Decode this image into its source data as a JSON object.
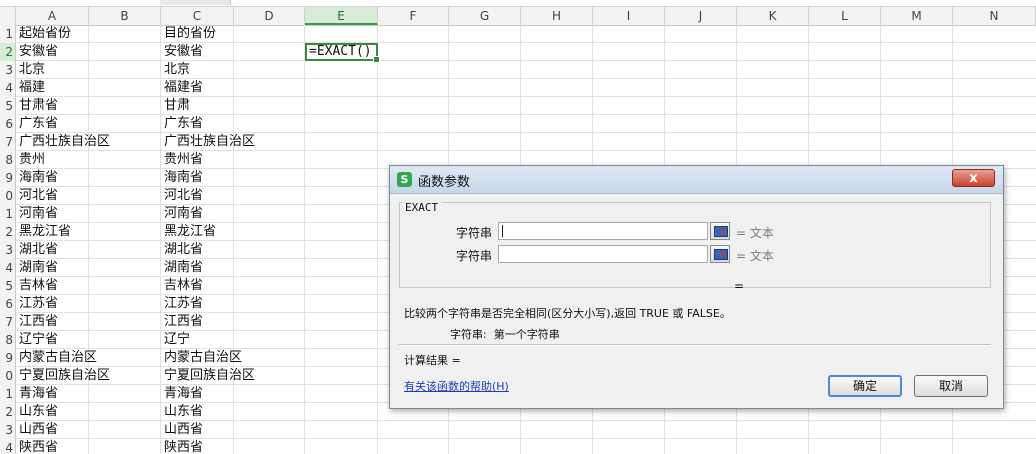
{
  "sheet": {
    "columns": [
      "A",
      "B",
      "C",
      "D",
      "E",
      "F",
      "G",
      "H",
      "I",
      "J",
      "K",
      "L",
      "M",
      "N"
    ],
    "active_column": "E",
    "row_labels": [
      "1",
      "2",
      "3",
      "4",
      "5",
      "6",
      "7",
      "8",
      "9",
      "0",
      "1",
      "2",
      "3",
      "4",
      "5",
      "6",
      "7",
      "8",
      "9",
      "0",
      "1",
      "2",
      "3",
      "4"
    ],
    "active_row_index": 1,
    "col_a": [
      "起始省份",
      "安徽省",
      "北京",
      "福建",
      "甘肃省",
      "广东省",
      "广西壮族自治区",
      "贵州",
      "海南省",
      "河北省",
      "河南省",
      "黑龙江省",
      "湖北省",
      "湖南省",
      "吉林省",
      "江苏省",
      "江西省",
      "辽宁省",
      "内蒙古自治区",
      "宁夏回族自治区",
      "青海省",
      "山东省",
      "山西省",
      "陕西省"
    ],
    "col_c": [
      "目的省份",
      "安徽省",
      "北京",
      "福建省",
      "甘肃",
      "广东省",
      "广西壮族自治区",
      "贵州省",
      "海南省",
      "河北省",
      "河南省",
      "黑龙江省",
      "湖北省",
      "湖南省",
      "吉林省",
      "江苏省",
      "江西省",
      "辽宁",
      "内蒙古自治区",
      "宁夏回族自治区",
      "青海省",
      "山东省",
      "山西省",
      "陕西省"
    ],
    "active_cell_formula": "=EXACT()"
  },
  "dialog": {
    "app_icon": "S",
    "title": "函数参数",
    "close_label": "x",
    "function_name": "EXACT",
    "args": [
      {
        "label": "字符串",
        "result": "= 文本"
      },
      {
        "label": "字符串",
        "result": "= 文本"
      }
    ],
    "middle_equals": "=",
    "description": "比较两个字符串是否完全相同(区分大小写),返回 TRUE 或 FALSE。",
    "param_name": "字符串:",
    "param_desc": "第一个字符串",
    "result_label": "计算结果 =",
    "help_link": "有关该函数的帮助(H)",
    "ok_label": "确定",
    "cancel_label": "取消"
  },
  "colors": {
    "accent_green": "#3a8a3a",
    "dialog_bg": "#f0f0f0",
    "close_red": "#c6452e",
    "link_blue": "#1a3fb8"
  }
}
